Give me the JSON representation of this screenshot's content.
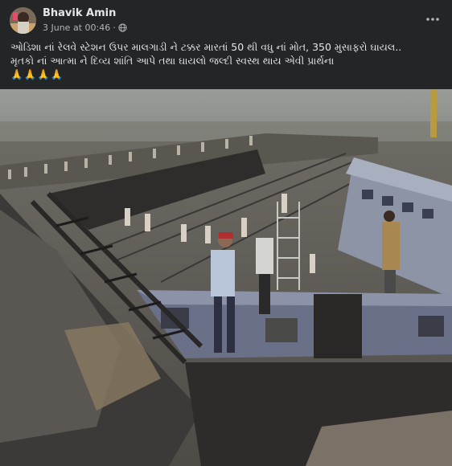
{
  "post": {
    "author": "Bhavik Amin",
    "timestamp": "3 June at 00:46",
    "separator": "·",
    "audience_icon": "globe-icon",
    "more_icon": "more-options-icon",
    "text_line1": "ઓડિશા નાં રેલવે સ્ટેશન ઉપર માલગાડી ને ટક્કર મારતાં 50 થી વધુ નાં મોત, 350 મુસાફરો ઘાયલ..",
    "text_line2": "મૃતકો નાં આત્મા ને દિવ્ય શાંતિ આપે તથા ઘાયલો જલ્દી સ્વસ્થ થાય એવી પ્રાર્થના",
    "emoji_line": "🙏🙏🙏🙏"
  },
  "colors": {
    "background": "#242526",
    "primary_text": "#e4e6eb",
    "secondary_text": "#b0b3b8"
  }
}
